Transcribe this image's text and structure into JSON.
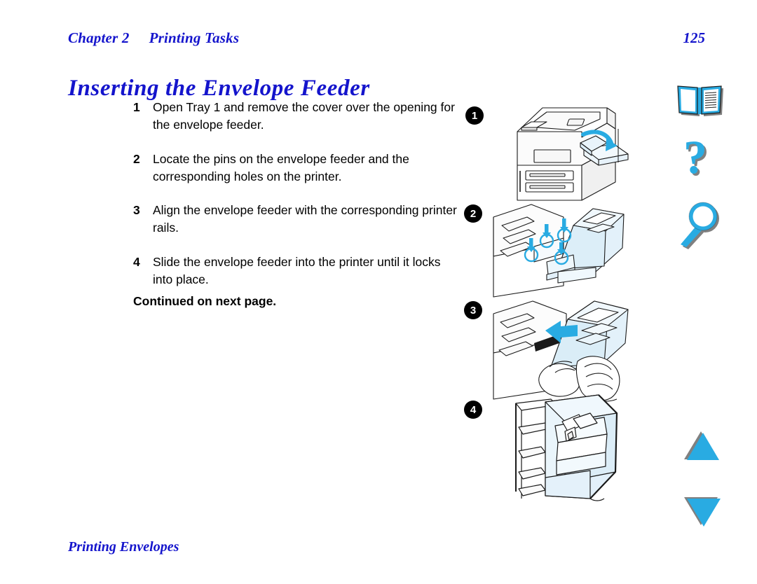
{
  "header": {
    "chapter_label": "Chapter 2",
    "chapter_title": "Printing Tasks",
    "page_number": "125"
  },
  "section": {
    "title": "Inserting the Envelope Feeder"
  },
  "steps": [
    {
      "num": "1",
      "text": "Open Tray 1 and remove the cover over the opening for the envelope feeder."
    },
    {
      "num": "2",
      "text": "Locate the pins on the envelope feeder and the corresponding holes on the printer."
    },
    {
      "num": "3",
      "text": "Align the envelope feeder with the corresponding printer rails."
    },
    {
      "num": "4",
      "text": "Slide the envelope feeder into the printer until it locks into place."
    }
  ],
  "continued_note": "Continued on next page.",
  "footer": {
    "text": "Printing Envelopes"
  },
  "callouts": [
    {
      "label": "1"
    },
    {
      "label": "2"
    },
    {
      "label": "3"
    },
    {
      "label": "4"
    }
  ],
  "illustrations": [
    {
      "caption_ref": "1",
      "description": "Printer with Tray 1 open and cover removed, cyan curved arrow showing door swinging down"
    },
    {
      "caption_ref": "2",
      "description": "Envelope feeder with cyan circles and down arrows marking pins and holes"
    },
    {
      "caption_ref": "3",
      "description": "Hands sliding the envelope feeder toward the printer, cyan arrow pointing left"
    },
    {
      "caption_ref": "4",
      "description": "Envelope feeder seated and locked into the printer"
    }
  ],
  "sidebar": {
    "icons": [
      {
        "name": "book-icon",
        "title": "Contents"
      },
      {
        "name": "question-mark-icon",
        "title": "Help"
      },
      {
        "name": "magnifier-icon",
        "title": "Search"
      },
      {
        "name": "up-triangle-icon",
        "title": "Previous page"
      },
      {
        "name": "down-triangle-icon",
        "title": "Next page"
      }
    ]
  },
  "colors": {
    "heading_blue": "#1414CC",
    "accent_cyan": "#29ABE2",
    "line_art": "#1A1A1A",
    "shadow_gray": "#808080",
    "fill_pale_blue": "#DCEEF8"
  }
}
